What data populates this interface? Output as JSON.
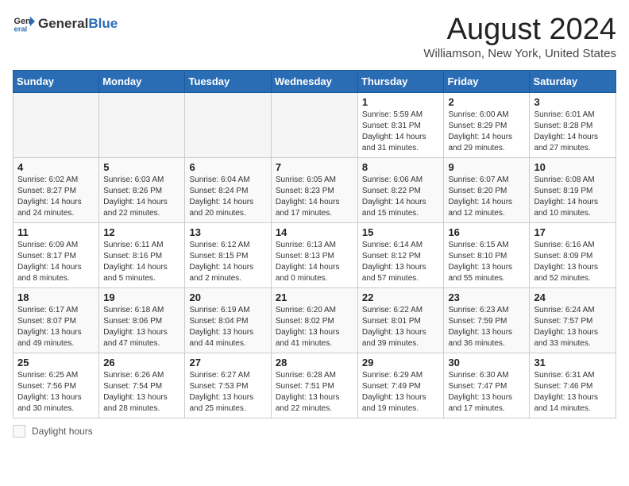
{
  "header": {
    "logo_general": "General",
    "logo_blue": "Blue",
    "title": "August 2024",
    "location": "Williamson, New York, United States"
  },
  "days_of_week": [
    "Sunday",
    "Monday",
    "Tuesday",
    "Wednesday",
    "Thursday",
    "Friday",
    "Saturday"
  ],
  "weeks": [
    [
      {
        "day": "",
        "info": ""
      },
      {
        "day": "",
        "info": ""
      },
      {
        "day": "",
        "info": ""
      },
      {
        "day": "",
        "info": ""
      },
      {
        "day": "1",
        "info": "Sunrise: 5:59 AM\nSunset: 8:31 PM\nDaylight: 14 hours and 31 minutes."
      },
      {
        "day": "2",
        "info": "Sunrise: 6:00 AM\nSunset: 8:29 PM\nDaylight: 14 hours and 29 minutes."
      },
      {
        "day": "3",
        "info": "Sunrise: 6:01 AM\nSunset: 8:28 PM\nDaylight: 14 hours and 27 minutes."
      }
    ],
    [
      {
        "day": "4",
        "info": "Sunrise: 6:02 AM\nSunset: 8:27 PM\nDaylight: 14 hours and 24 minutes."
      },
      {
        "day": "5",
        "info": "Sunrise: 6:03 AM\nSunset: 8:26 PM\nDaylight: 14 hours and 22 minutes."
      },
      {
        "day": "6",
        "info": "Sunrise: 6:04 AM\nSunset: 8:24 PM\nDaylight: 14 hours and 20 minutes."
      },
      {
        "day": "7",
        "info": "Sunrise: 6:05 AM\nSunset: 8:23 PM\nDaylight: 14 hours and 17 minutes."
      },
      {
        "day": "8",
        "info": "Sunrise: 6:06 AM\nSunset: 8:22 PM\nDaylight: 14 hours and 15 minutes."
      },
      {
        "day": "9",
        "info": "Sunrise: 6:07 AM\nSunset: 8:20 PM\nDaylight: 14 hours and 12 minutes."
      },
      {
        "day": "10",
        "info": "Sunrise: 6:08 AM\nSunset: 8:19 PM\nDaylight: 14 hours and 10 minutes."
      }
    ],
    [
      {
        "day": "11",
        "info": "Sunrise: 6:09 AM\nSunset: 8:17 PM\nDaylight: 14 hours and 8 minutes."
      },
      {
        "day": "12",
        "info": "Sunrise: 6:11 AM\nSunset: 8:16 PM\nDaylight: 14 hours and 5 minutes."
      },
      {
        "day": "13",
        "info": "Sunrise: 6:12 AM\nSunset: 8:15 PM\nDaylight: 14 hours and 2 minutes."
      },
      {
        "day": "14",
        "info": "Sunrise: 6:13 AM\nSunset: 8:13 PM\nDaylight: 14 hours and 0 minutes."
      },
      {
        "day": "15",
        "info": "Sunrise: 6:14 AM\nSunset: 8:12 PM\nDaylight: 13 hours and 57 minutes."
      },
      {
        "day": "16",
        "info": "Sunrise: 6:15 AM\nSunset: 8:10 PM\nDaylight: 13 hours and 55 minutes."
      },
      {
        "day": "17",
        "info": "Sunrise: 6:16 AM\nSunset: 8:09 PM\nDaylight: 13 hours and 52 minutes."
      }
    ],
    [
      {
        "day": "18",
        "info": "Sunrise: 6:17 AM\nSunset: 8:07 PM\nDaylight: 13 hours and 49 minutes."
      },
      {
        "day": "19",
        "info": "Sunrise: 6:18 AM\nSunset: 8:06 PM\nDaylight: 13 hours and 47 minutes."
      },
      {
        "day": "20",
        "info": "Sunrise: 6:19 AM\nSunset: 8:04 PM\nDaylight: 13 hours and 44 minutes."
      },
      {
        "day": "21",
        "info": "Sunrise: 6:20 AM\nSunset: 8:02 PM\nDaylight: 13 hours and 41 minutes."
      },
      {
        "day": "22",
        "info": "Sunrise: 6:22 AM\nSunset: 8:01 PM\nDaylight: 13 hours and 39 minutes."
      },
      {
        "day": "23",
        "info": "Sunrise: 6:23 AM\nSunset: 7:59 PM\nDaylight: 13 hours and 36 minutes."
      },
      {
        "day": "24",
        "info": "Sunrise: 6:24 AM\nSunset: 7:57 PM\nDaylight: 13 hours and 33 minutes."
      }
    ],
    [
      {
        "day": "25",
        "info": "Sunrise: 6:25 AM\nSunset: 7:56 PM\nDaylight: 13 hours and 30 minutes."
      },
      {
        "day": "26",
        "info": "Sunrise: 6:26 AM\nSunset: 7:54 PM\nDaylight: 13 hours and 28 minutes."
      },
      {
        "day": "27",
        "info": "Sunrise: 6:27 AM\nSunset: 7:53 PM\nDaylight: 13 hours and 25 minutes."
      },
      {
        "day": "28",
        "info": "Sunrise: 6:28 AM\nSunset: 7:51 PM\nDaylight: 13 hours and 22 minutes."
      },
      {
        "day": "29",
        "info": "Sunrise: 6:29 AM\nSunset: 7:49 PM\nDaylight: 13 hours and 19 minutes."
      },
      {
        "day": "30",
        "info": "Sunrise: 6:30 AM\nSunset: 7:47 PM\nDaylight: 13 hours and 17 minutes."
      },
      {
        "day": "31",
        "info": "Sunrise: 6:31 AM\nSunset: 7:46 PM\nDaylight: 13 hours and 14 minutes."
      }
    ]
  ],
  "footer": {
    "daylight_label": "Daylight hours"
  }
}
